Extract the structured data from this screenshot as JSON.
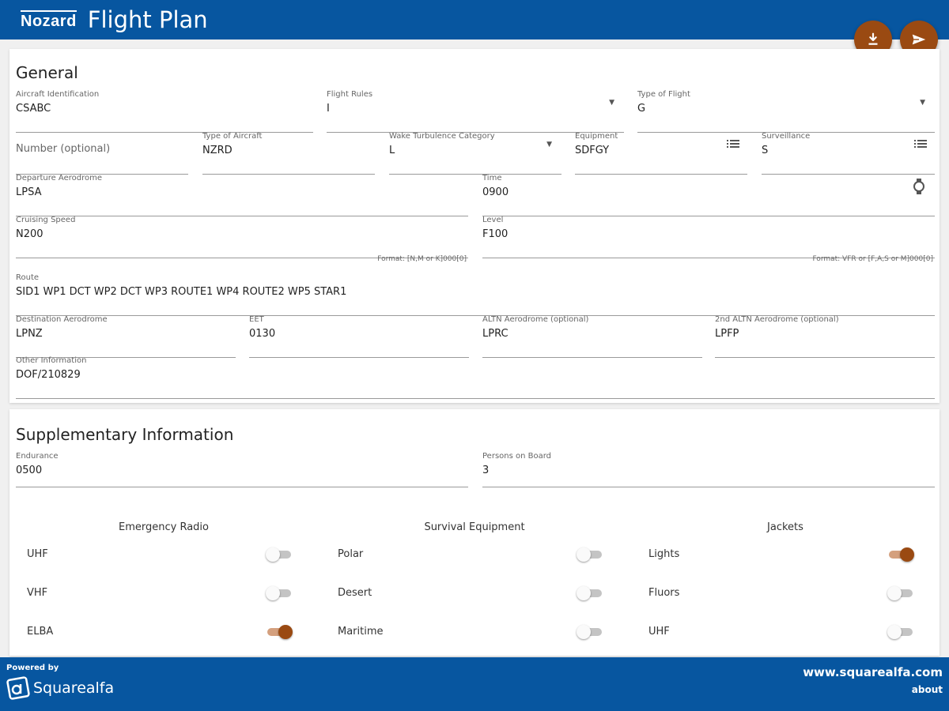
{
  "header": {
    "logo_text": "Nozard",
    "title": "Flight Plan"
  },
  "actions": {
    "download_icon": "download-icon",
    "send_icon": "send-icon"
  },
  "general": {
    "title": "General",
    "aircraft_id": {
      "label": "Aircraft Identification",
      "value": "CSABC"
    },
    "flight_rules": {
      "label": "Flight Rules",
      "value": "I"
    },
    "type_of_flight": {
      "label": "Type of Flight",
      "value": "G"
    },
    "number": {
      "placeholder": "Number (optional)"
    },
    "type_of_aircraft": {
      "label": "Type of Aircraft",
      "value": "NZRD"
    },
    "wake_turbulence": {
      "label": "Wake Turbulence Category",
      "value": "L"
    },
    "equipment": {
      "label": "Equipment",
      "value": "SDFGY"
    },
    "surveillance": {
      "label": "Surveillance",
      "value": "S"
    },
    "departure": {
      "label": "Departure Aerodrome",
      "value": "LPSA"
    },
    "time": {
      "label": "Time",
      "value": "0900"
    },
    "cruising_speed": {
      "label": "Cruising Speed",
      "value": "N200",
      "hint": "Format: [N,M or K]000[0]"
    },
    "level": {
      "label": "Level",
      "value": "F100",
      "hint": "Format: VFR or [F,A,S or M]000[0]"
    },
    "route": {
      "label": "Route",
      "value": "SID1 WP1 DCT WP2 DCT WP3 ROUTE1 WP4 ROUTE2 WP5 STAR1"
    },
    "destination": {
      "label": "Destination Aerodrome",
      "value": "LPNZ"
    },
    "eet": {
      "label": "EET",
      "value": "0130"
    },
    "altn": {
      "label": "ALTN Aerodrome (optional)",
      "value": "LPRC"
    },
    "altn2": {
      "label": "2nd ALTN Aerodrome (optional)",
      "value": "LPFP"
    },
    "other": {
      "label": "Other Information",
      "value": "DOF/210829"
    }
  },
  "supplementary": {
    "title": "Supplementary Information",
    "endurance": {
      "label": "Endurance",
      "value": "0500"
    },
    "persons": {
      "label": "Persons on Board",
      "value": "3"
    },
    "groups": [
      {
        "title": "Emergency Radio",
        "items": [
          {
            "label": "UHF",
            "on": false
          },
          {
            "label": "VHF",
            "on": false
          },
          {
            "label": "ELBA",
            "on": true
          }
        ]
      },
      {
        "title": "Survival Equipment",
        "items": [
          {
            "label": "Polar",
            "on": false
          },
          {
            "label": "Desert",
            "on": false
          },
          {
            "label": "Maritime",
            "on": false
          }
        ]
      },
      {
        "title": "Jackets",
        "items": [
          {
            "label": "Lights",
            "on": true
          },
          {
            "label": "Fluors",
            "on": false
          },
          {
            "label": "UHF",
            "on": false
          }
        ]
      }
    ]
  },
  "footer": {
    "powered_by": "Powered by",
    "brand": "Squarealfa",
    "site": "www.squarealfa.com",
    "about": "about"
  },
  "colors": {
    "primary": "#0756a0",
    "accent": "#9a4a12",
    "accent_track": "#d4a07e"
  }
}
